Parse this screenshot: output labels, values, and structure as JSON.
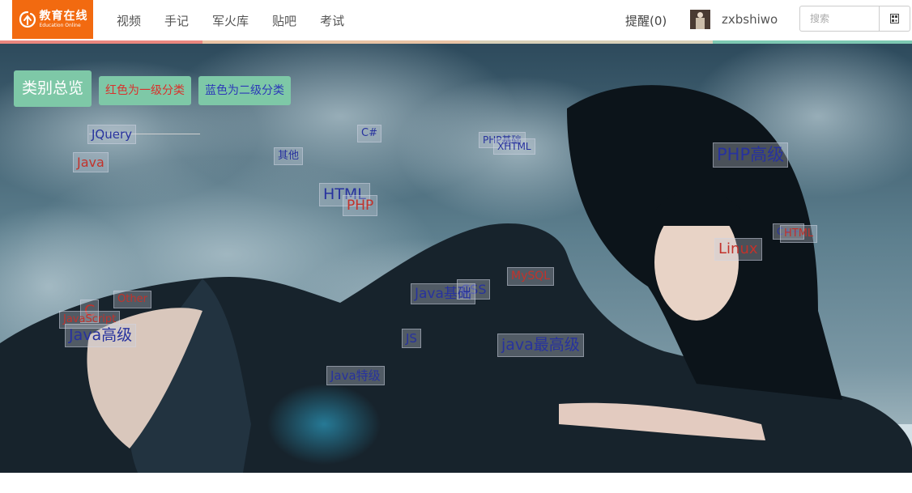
{
  "header": {
    "logo_cn": "教育在线",
    "logo_en": "Education Online",
    "nav": [
      "视频",
      "手记",
      "军火库",
      "贴吧",
      "考试"
    ],
    "remind": "提醒(0)",
    "username": "zxbshiwo",
    "search_placeholder": "搜索"
  },
  "banner": {
    "btn_main": "类别总览",
    "btn_red": "红色为一级分类",
    "btn_blue": "蓝色为二级分类"
  },
  "tags": [
    {
      "text": "JQuery",
      "level": "blue",
      "size": 15
    },
    {
      "text": "Java",
      "level": "red",
      "size": 16
    },
    {
      "text": "C#",
      "level": "blue",
      "size": 13
    },
    {
      "text": "其他",
      "level": "blue",
      "size": 13
    },
    {
      "text": "PHP基础",
      "level": "blue",
      "size": 12
    },
    {
      "text": "XHTML",
      "level": "blue",
      "size": 12
    },
    {
      "text": "PHP高级",
      "level": "blue",
      "size": 21
    },
    {
      "text": "HTML",
      "level": "blue",
      "size": 19
    },
    {
      "text": "PHP",
      "level": "red",
      "size": 17
    },
    {
      "text": "C++",
      "level": "blue",
      "size": 12
    },
    {
      "text": "HTML",
      "level": "red",
      "size": 13
    },
    {
      "text": "Linux",
      "level": "red",
      "size": 18
    },
    {
      "text": "MySQL",
      "level": "red",
      "size": 14
    },
    {
      "text": "CSS",
      "level": "blue",
      "size": 16
    },
    {
      "text": "Java基础",
      "level": "blue",
      "size": 17
    },
    {
      "text": "Other",
      "level": "red",
      "size": 13
    },
    {
      "text": "C",
      "level": "red",
      "size": 19
    },
    {
      "text": "JavaScript",
      "level": "red",
      "size": 13
    },
    {
      "text": "Java高级",
      "level": "blue",
      "size": 19
    },
    {
      "text": "JS",
      "level": "blue",
      "size": 15
    },
    {
      "text": "java最高级",
      "level": "blue",
      "size": 19
    },
    {
      "text": "Java特级",
      "level": "blue",
      "size": 15
    }
  ],
  "colors": {
    "brand_orange": "#f26a10",
    "button_green": "#7ec8a7",
    "first_level_red": "#c2322b",
    "second_level_blue": "#27329e"
  },
  "icons": {
    "logo": "education-online-logo-icon",
    "qr": "qr-code-icon"
  }
}
